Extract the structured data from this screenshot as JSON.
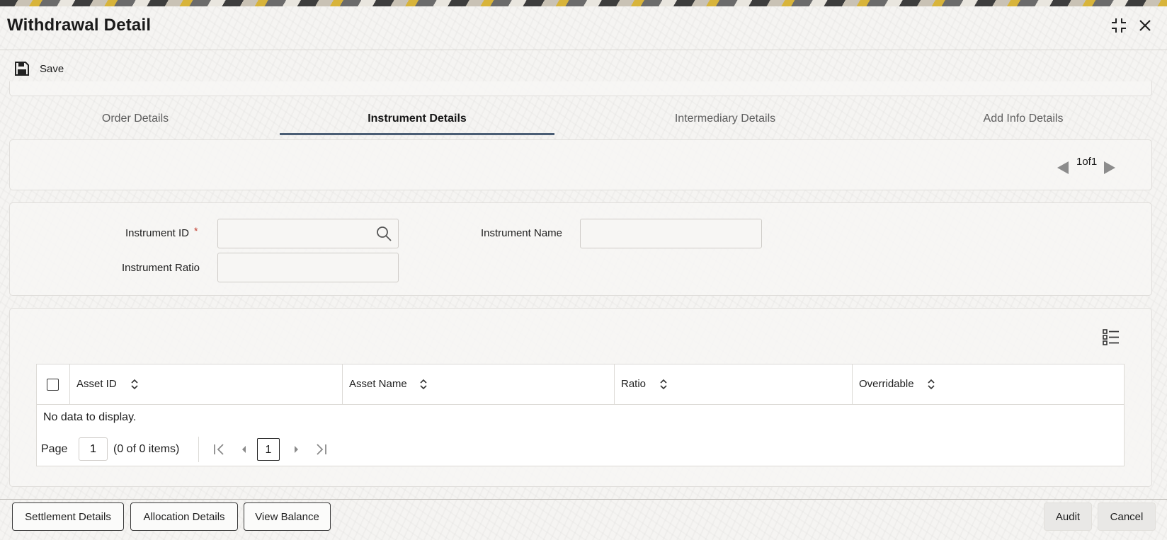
{
  "window": {
    "title": "Withdrawal Detail",
    "maximize_icon": "maximize-icon",
    "close_icon": "close-icon"
  },
  "toolbar": {
    "save_label": "Save",
    "save_icon": "floppy-disk-icon"
  },
  "tabs": [
    {
      "label": "Order Details",
      "active": false
    },
    {
      "label": "Instrument Details",
      "active": true
    },
    {
      "label": "Intermediary Details",
      "active": false
    },
    {
      "label": "Add Info Details",
      "active": false
    }
  ],
  "record_nav": {
    "text": "1of1"
  },
  "form": {
    "instrument_id": {
      "label": "Instrument ID",
      "required_mark": "*",
      "value": "",
      "icon": "search-icon"
    },
    "instrument_name": {
      "label": "Instrument Name",
      "value": ""
    },
    "instrument_ratio": {
      "label": "Instrument Ratio",
      "value": ""
    }
  },
  "grid": {
    "columns_icon": "column-list-icon",
    "columns": [
      "Asset ID",
      "Asset Name",
      "Ratio",
      "Overridable"
    ],
    "empty_text": "No data to display.",
    "pagination": {
      "page_label": "Page",
      "page_value": "1",
      "items_text": "(0 of 0 items)",
      "current_page": "1"
    }
  },
  "footer": {
    "buttons_left": [
      "Settlement Details",
      "Allocation Details",
      "View Balance"
    ],
    "audit_label": "Audit",
    "cancel_label": "Cancel"
  },
  "colors": {
    "accent": "#4a5d74",
    "required": "#c0392b",
    "nav_arrow": "#8c8c8c"
  }
}
